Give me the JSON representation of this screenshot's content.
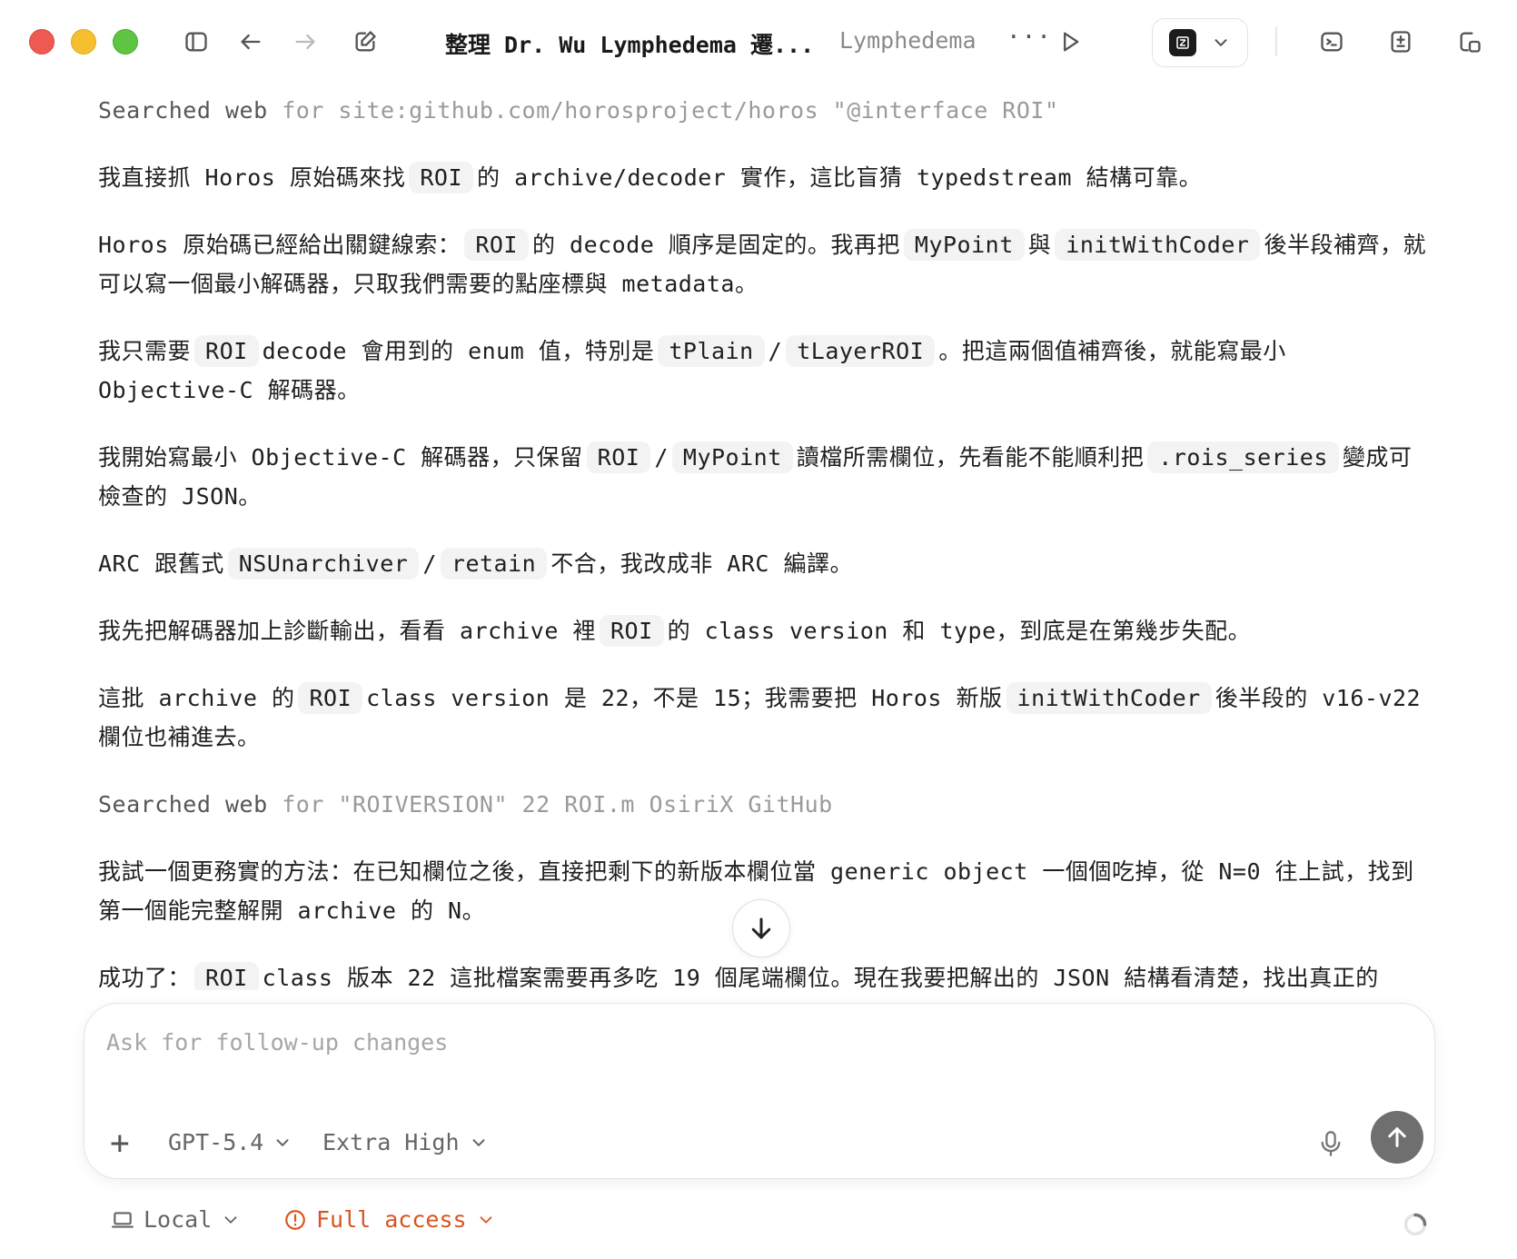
{
  "window": {
    "title": "整理 Dr. Wu Lymphedema 遷...",
    "subtitle": "Lymphedema",
    "more_label": "···"
  },
  "content": {
    "search1_lead": "Searched web",
    "search1_rest": "for site:github.com/horosproject/horos \"@interface ROI\"",
    "p1": [
      {
        "t": "我直接抓 Horos 原始碼來找"
      },
      {
        "c": "ROI"
      },
      {
        "t": "的 archive/decoder 實作，這比盲猜 typedstream 結構可靠。"
      }
    ],
    "p2": [
      {
        "t": "Horos 原始碼已經給出關鍵線索："
      },
      {
        "c": "ROI"
      },
      {
        "t": "的 decode 順序是固定的。我再把"
      },
      {
        "c": "MyPoint"
      },
      {
        "t": "與"
      },
      {
        "c": "initWithCoder"
      },
      {
        "t": "後半段補齊，就可以寫一個最小解碼器，只取我們需要的點座標與 metadata。"
      }
    ],
    "p3": [
      {
        "t": "我只需要"
      },
      {
        "c": "ROI"
      },
      {
        "t": "decode 會用到的 enum 值，特別是"
      },
      {
        "c": "tPlain"
      },
      {
        "t": "/"
      },
      {
        "c": "tLayerROI"
      },
      {
        "t": "。把這兩個值補齊後，就能寫最小 Objective-C 解碼器。"
      }
    ],
    "p4": [
      {
        "t": "我開始寫最小 Objective-C 解碼器，只保留"
      },
      {
        "c": "ROI"
      },
      {
        "t": "/"
      },
      {
        "c": "MyPoint"
      },
      {
        "t": "讀檔所需欄位，先看能不能順利把"
      },
      {
        "c": ".rois_series"
      },
      {
        "t": "變成可檢查的 JSON。"
      }
    ],
    "p5": [
      {
        "t": "ARC 跟舊式"
      },
      {
        "c": "NSUnarchiver"
      },
      {
        "t": "/"
      },
      {
        "c": "retain"
      },
      {
        "t": "不合，我改成非 ARC 編譯。"
      }
    ],
    "p6": [
      {
        "t": "我先把解碼器加上診斷輸出，看看 archive 裡"
      },
      {
        "c": "ROI"
      },
      {
        "t": "的 class version 和 type，到底是在第幾步失配。"
      }
    ],
    "p7": [
      {
        "t": "這批 archive 的"
      },
      {
        "c": "ROI"
      },
      {
        "t": "class version 是 22，不是 15；我需要把 Horos 新版"
      },
      {
        "c": "initWithCoder"
      },
      {
        "t": "後半段的 v16-v22 欄位也補進去。"
      }
    ],
    "search2_lead": "Searched web",
    "search2_rest": "for \"ROIVERSION\" 22 ROI.m OsiriX GitHub",
    "p8": [
      {
        "t": "我試一個更務實的方法：在已知欄位之後，直接把剩下的新版本欄位當 generic object 一個個吃掉，從 N=0 往上試，找到第一個能完整解開 archive 的 N。"
      }
    ],
    "p9": [
      {
        "t": "成功了："
      },
      {
        "c": "ROI"
      },
      {
        "t": "class 版本 22 這批檔案需要再多吃 19 個尾端欄位。現在我要把解出的 JSON 結構看清楚，找出真正的"
      }
    ]
  },
  "composer": {
    "placeholder": "Ask for follow-up changes",
    "plus_label": "+",
    "model_label": "GPT-5.4",
    "effort_label": "Extra High"
  },
  "footer": {
    "local_label": "Local",
    "access_label": "Full access"
  },
  "colors": {
    "accent_warning": "#d9541e",
    "send_button": "#6f6f6f"
  }
}
